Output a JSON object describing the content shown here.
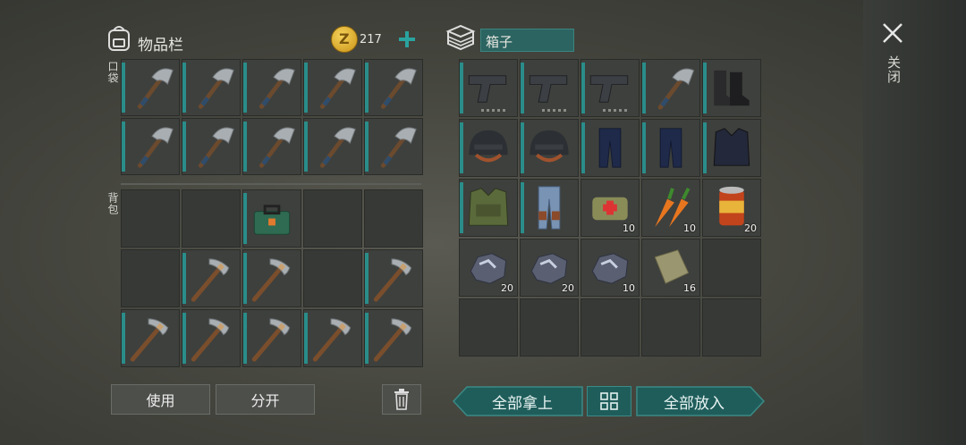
{
  "inventory": {
    "title": "物品栏",
    "coins": "217",
    "pockets_label": "口袋",
    "backpack_label": "背包",
    "pocket_slots": [
      {
        "icon": "hatchet-icon"
      },
      {
        "icon": "hatchet-icon"
      },
      {
        "icon": "hatchet-icon"
      },
      {
        "icon": "hatchet-icon"
      },
      {
        "icon": "hatchet-icon"
      },
      {
        "icon": "hatchet-icon"
      },
      {
        "icon": "hatchet-icon"
      },
      {
        "icon": "hatchet-icon"
      },
      {
        "icon": "hatchet-icon"
      },
      {
        "icon": "hatchet-icon"
      }
    ],
    "backpack_slots": [
      {
        "icon": ""
      },
      {
        "icon": ""
      },
      {
        "icon": "toolbox-icon"
      },
      {
        "icon": ""
      },
      {
        "icon": ""
      },
      {
        "icon": ""
      },
      {
        "icon": "pickaxe-icon"
      },
      {
        "icon": "pickaxe-icon"
      },
      {
        "icon": ""
      },
      {
        "icon": "pickaxe-icon"
      },
      {
        "icon": "pickaxe-icon"
      },
      {
        "icon": "pickaxe-icon"
      },
      {
        "icon": "pickaxe-icon"
      },
      {
        "icon": "pickaxe-icon"
      },
      {
        "icon": "pickaxe-icon"
      }
    ],
    "use_label": "使用",
    "split_label": "分开"
  },
  "box": {
    "title": "箱子",
    "slots": [
      {
        "icon": "pistol-icon",
        "count": ""
      },
      {
        "icon": "pistol-icon",
        "count": ""
      },
      {
        "icon": "pistol-icon",
        "count": ""
      },
      {
        "icon": "hatchet-icon",
        "count": ""
      },
      {
        "icon": "boots-icon",
        "count": ""
      },
      {
        "icon": "helmet-icon",
        "count": ""
      },
      {
        "icon": "helmet-icon",
        "count": ""
      },
      {
        "icon": "pants-icon",
        "count": ""
      },
      {
        "icon": "pants-icon",
        "count": ""
      },
      {
        "icon": "vest-icon",
        "count": ""
      },
      {
        "icon": "camo-vest-icon",
        "count": ""
      },
      {
        "icon": "jeans-icon",
        "count": ""
      },
      {
        "icon": "medkit-icon",
        "count": "10"
      },
      {
        "icon": "carrot-icon",
        "count": "10"
      },
      {
        "icon": "canned-food-icon",
        "count": "20"
      },
      {
        "icon": "iron-ore-icon",
        "count": "20"
      },
      {
        "icon": "iron-ore-icon",
        "count": "20"
      },
      {
        "icon": "iron-ore-icon",
        "count": "10"
      },
      {
        "icon": "cloth-icon",
        "count": "16"
      },
      {
        "icon": "",
        "count": ""
      },
      {
        "icon": "",
        "count": ""
      },
      {
        "icon": "",
        "count": ""
      },
      {
        "icon": "",
        "count": ""
      },
      {
        "icon": "",
        "count": ""
      },
      {
        "icon": "",
        "count": ""
      }
    ],
    "take_all_label": "全部拿上",
    "put_all_label": "全部放入"
  },
  "close_label": "关闭",
  "colors": {
    "accent": "#1f5d5b",
    "bar": "#2a8d8a",
    "plus": "#2aa39f"
  }
}
